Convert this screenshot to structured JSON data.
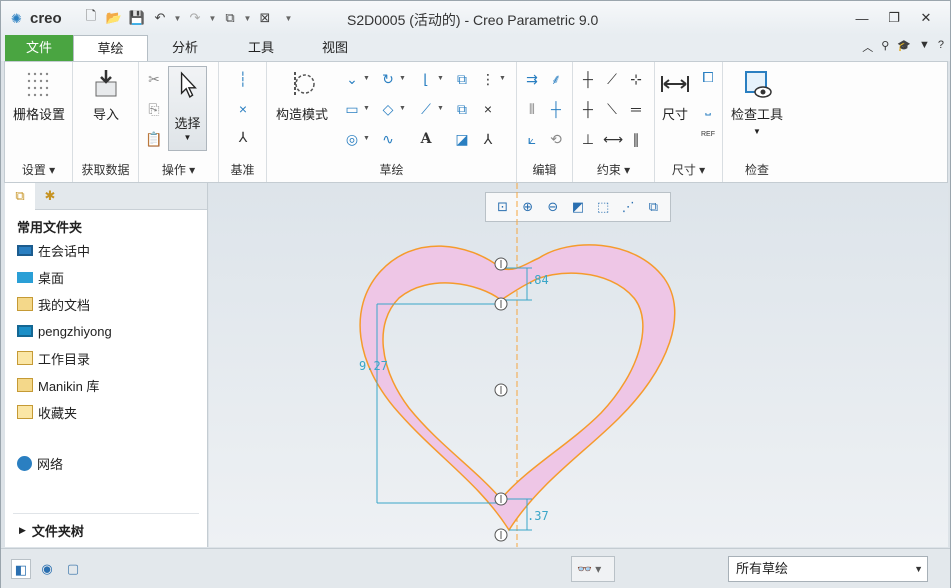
{
  "app": {
    "logo_text": "creo",
    "window_title": "S2D0005 (活动的) - Creo Parametric 9.0"
  },
  "colors": {
    "file_tab": "#4aa541",
    "sketch_fill": "#eec6e6",
    "sketch_edge": "#f59b2c",
    "dimension": "#3aa6c8",
    "centerline": "#f5a640"
  },
  "menu": {
    "tabs": [
      "文件",
      "草绘",
      "分析",
      "工具",
      "视图"
    ],
    "active_tab": "草绘"
  },
  "ribbon": {
    "settings": {
      "button": "栅格设置",
      "group": "设置"
    },
    "get_data": {
      "button": "导入",
      "group": "获取数据"
    },
    "operations": {
      "button": "选择",
      "group": "操作"
    },
    "datum": {
      "group": "基准"
    },
    "sketch": {
      "button": "构造模式",
      "group": "草绘",
      "text_icon": "A"
    },
    "edit": {
      "group": "编辑"
    },
    "constrain": {
      "group": "约束"
    },
    "dimension": {
      "button": "尺寸",
      "group": "尺寸",
      "ref_label": "REF"
    },
    "inspect": {
      "button": "检查工具",
      "group": "检查"
    }
  },
  "left_panel": {
    "header": "常用文件夹",
    "items": [
      "在会话中",
      "桌面",
      "我的文档",
      "pengzhiyong",
      "工作目录",
      "Manikin 库",
      "收藏夹"
    ],
    "network": "网络",
    "folder_tree": "文件夹树"
  },
  "canvas": {
    "dimensions": {
      "top": ".84",
      "height": "9.27",
      "bottom": ".37"
    }
  },
  "status": {
    "filter_value": "所有草绘"
  }
}
